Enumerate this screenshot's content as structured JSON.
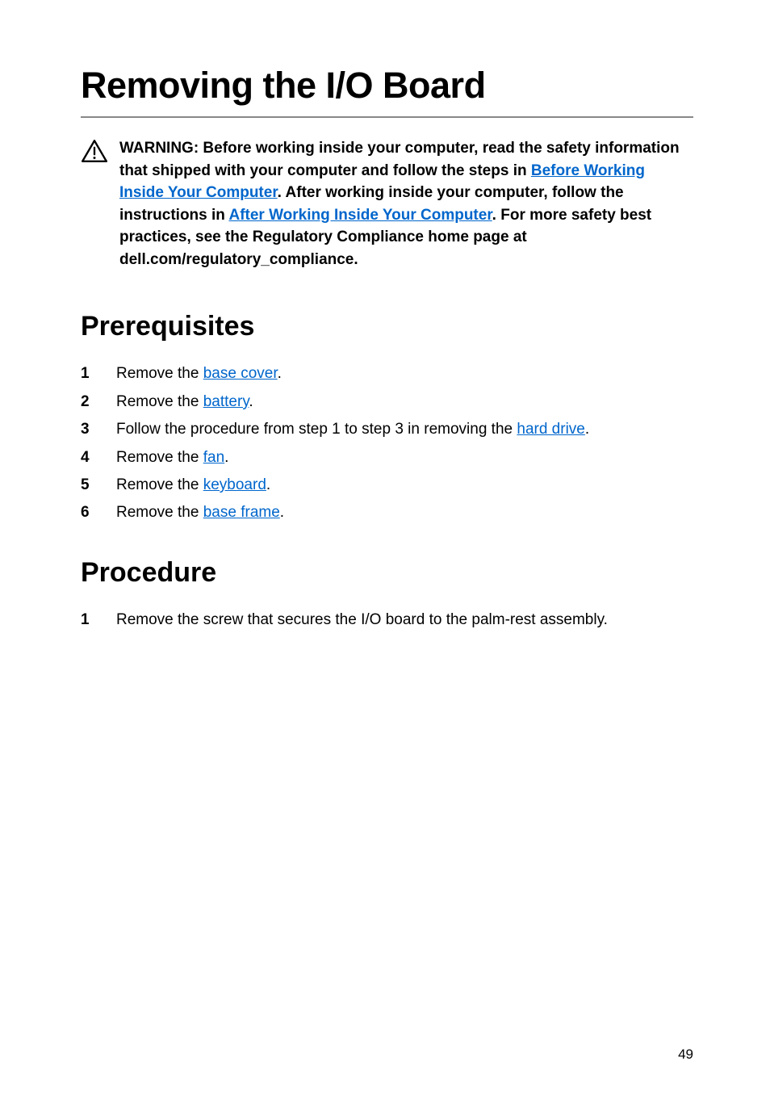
{
  "title": "Removing the I/O Board",
  "warning": {
    "pre": "WARNING: Before working inside your computer, read the safety information that shipped with your computer and follow the steps in ",
    "link1": "Before Working Inside Your Computer",
    "mid1": ". After working inside your computer, follow the instructions in ",
    "link2": "After Working Inside Your Computer",
    "post": ". For more safety best practices, see the Regulatory Compliance home page at dell.com/regulatory_compliance."
  },
  "sections": {
    "prereq_heading": "Prerequisites",
    "proc_heading": "Procedure"
  },
  "prereqs": [
    {
      "pre": "Remove the ",
      "link": "base cover",
      "post": "."
    },
    {
      "pre": "Remove the ",
      "link": "battery",
      "post": "."
    },
    {
      "pre": "Follow the procedure from step 1 to step 3 in removing the ",
      "link": "hard drive",
      "post": "."
    },
    {
      "pre": "Remove the ",
      "link": "fan",
      "post": "."
    },
    {
      "pre": "Remove the ",
      "link": "keyboard",
      "post": "."
    },
    {
      "pre": "Remove the ",
      "link": "base frame",
      "post": "."
    }
  ],
  "procedure": [
    {
      "text": "Remove the screw that secures the I/O board to the palm-rest assembly."
    }
  ],
  "page_number": "49"
}
